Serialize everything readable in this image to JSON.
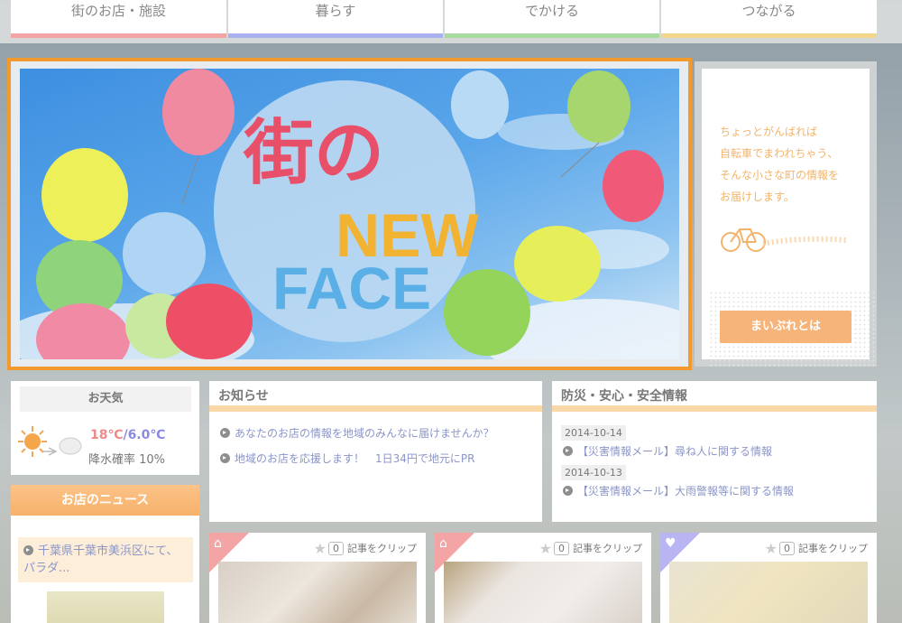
{
  "nav": {
    "tabs": [
      {
        "label": "街のお店・施設",
        "color": "#f3a5a5"
      },
      {
        "label": "暮らす",
        "color": "#aab0f0"
      },
      {
        "label": "でかける",
        "color": "#a8dba0"
      },
      {
        "label": "つながる",
        "color": "#f3d68c"
      }
    ]
  },
  "hero": {
    "title_line1": "街の",
    "title_word1": "NEW",
    "title_word2": "FACE",
    "border_color": "#f39a2e"
  },
  "intro": {
    "text": "ちょっとがんばれば\n自転車でまわれちゃう、\nそんな小さな町の情報を\nお届けします。",
    "button": "まいぷれとは"
  },
  "weather": {
    "title": "お天気",
    "high": "18℃",
    "slash": "/",
    "low": "6.0℃",
    "rain_label": "降水確率 10%"
  },
  "shop_news": {
    "title": "お店のニュース",
    "item": "千葉県千葉市美浜区にて、パラダ..."
  },
  "notice": {
    "title": "お知らせ",
    "items": [
      "あなたのお店の情報を地域のみんなに届けませんか？",
      "地域のお店を応援します！　1日34円で地元にPR"
    ]
  },
  "safety": {
    "title": "防災・安心・安全情報",
    "entries": [
      {
        "date": "2014-10-14",
        "text": "【災害情報メール】尋ね人に関する情報"
      },
      {
        "date": "2014-10-13",
        "text": "【災害情報メール】大雨警報等に関する情報"
      }
    ]
  },
  "cards": [
    {
      "icon": "house-icon",
      "count": "0",
      "clip_label": "記事をクリップ"
    },
    {
      "icon": "house-icon",
      "count": "0",
      "clip_label": "記事をクリップ"
    },
    {
      "icon": "heart-icon",
      "count": "0",
      "clip_label": "記事をクリップ"
    }
  ]
}
